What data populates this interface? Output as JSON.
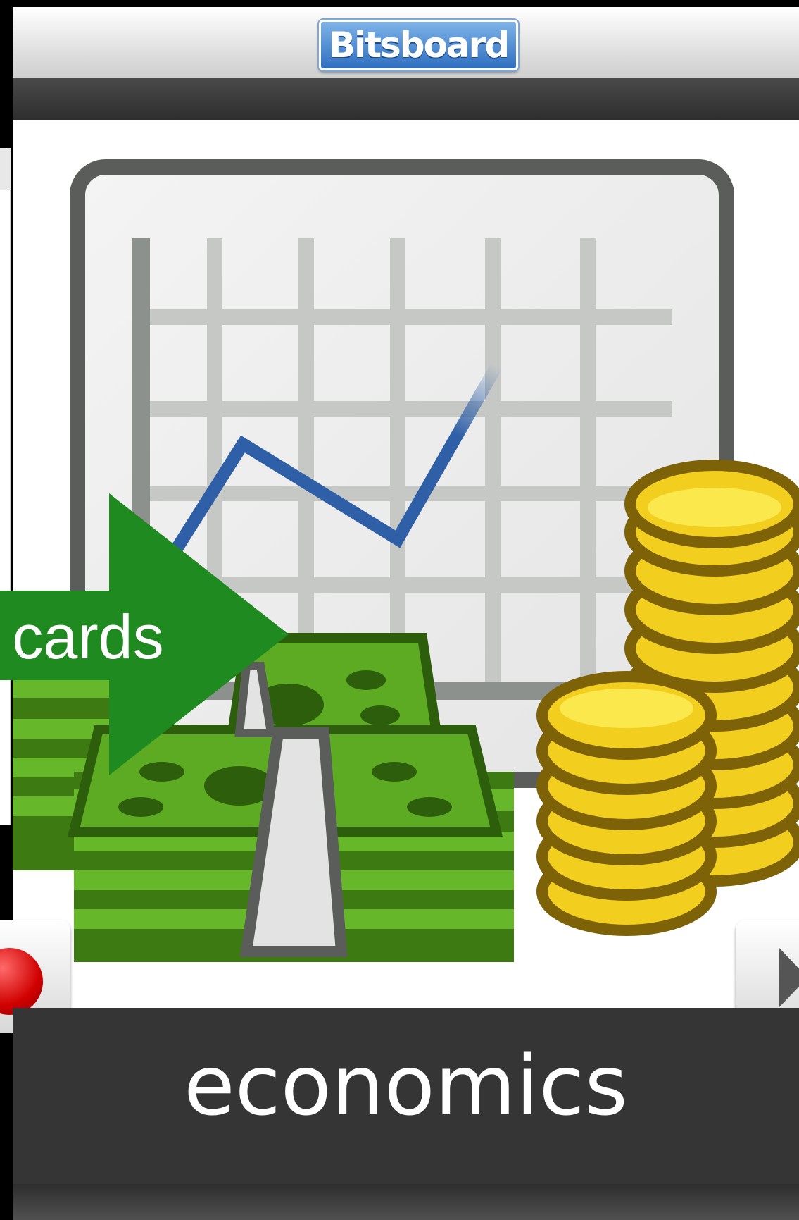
{
  "app": {
    "name": "Bitsboard"
  },
  "card": {
    "word": "economics"
  },
  "callout": {
    "text": "n cards",
    "color": "#1f8a1f"
  },
  "icons": [
    "record-icon",
    "play-icon",
    "chart-icon",
    "money-stack-icon",
    "coin-stack-icon"
  ],
  "colors": {
    "header": "#dcdcdc",
    "word_bar": "#353535",
    "record": "#d00000",
    "logo": "#2f6fc0"
  }
}
